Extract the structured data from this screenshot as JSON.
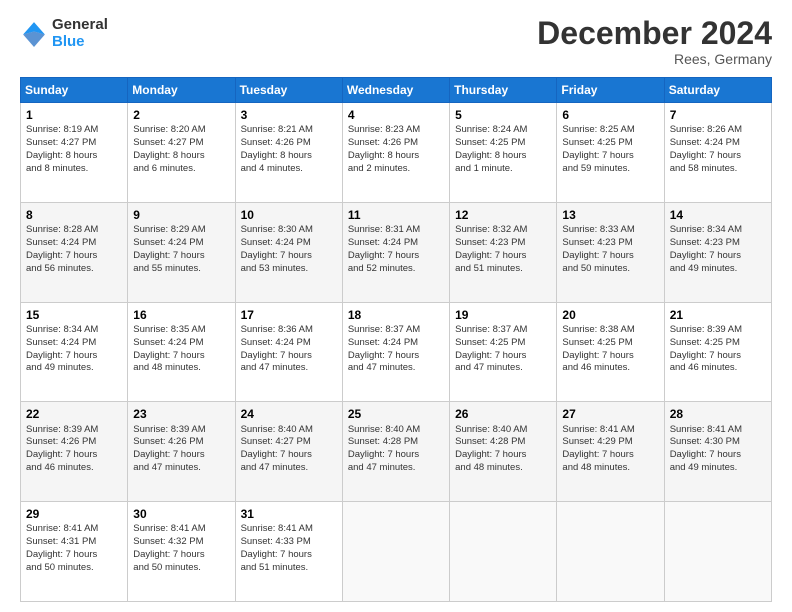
{
  "header": {
    "logo_line1": "General",
    "logo_line2": "Blue",
    "month": "December 2024",
    "location": "Rees, Germany"
  },
  "days_of_week": [
    "Sunday",
    "Monday",
    "Tuesday",
    "Wednesday",
    "Thursday",
    "Friday",
    "Saturday"
  ],
  "weeks": [
    [
      {
        "day": "1",
        "info": "Sunrise: 8:19 AM\nSunset: 4:27 PM\nDaylight: 8 hours\nand 8 minutes."
      },
      {
        "day": "2",
        "info": "Sunrise: 8:20 AM\nSunset: 4:27 PM\nDaylight: 8 hours\nand 6 minutes."
      },
      {
        "day": "3",
        "info": "Sunrise: 8:21 AM\nSunset: 4:26 PM\nDaylight: 8 hours\nand 4 minutes."
      },
      {
        "day": "4",
        "info": "Sunrise: 8:23 AM\nSunset: 4:26 PM\nDaylight: 8 hours\nand 2 minutes."
      },
      {
        "day": "5",
        "info": "Sunrise: 8:24 AM\nSunset: 4:25 PM\nDaylight: 8 hours\nand 1 minute."
      },
      {
        "day": "6",
        "info": "Sunrise: 8:25 AM\nSunset: 4:25 PM\nDaylight: 7 hours\nand 59 minutes."
      },
      {
        "day": "7",
        "info": "Sunrise: 8:26 AM\nSunset: 4:24 PM\nDaylight: 7 hours\nand 58 minutes."
      }
    ],
    [
      {
        "day": "8",
        "info": "Sunrise: 8:28 AM\nSunset: 4:24 PM\nDaylight: 7 hours\nand 56 minutes."
      },
      {
        "day": "9",
        "info": "Sunrise: 8:29 AM\nSunset: 4:24 PM\nDaylight: 7 hours\nand 55 minutes."
      },
      {
        "day": "10",
        "info": "Sunrise: 8:30 AM\nSunset: 4:24 PM\nDaylight: 7 hours\nand 53 minutes."
      },
      {
        "day": "11",
        "info": "Sunrise: 8:31 AM\nSunset: 4:24 PM\nDaylight: 7 hours\nand 52 minutes."
      },
      {
        "day": "12",
        "info": "Sunrise: 8:32 AM\nSunset: 4:23 PM\nDaylight: 7 hours\nand 51 minutes."
      },
      {
        "day": "13",
        "info": "Sunrise: 8:33 AM\nSunset: 4:23 PM\nDaylight: 7 hours\nand 50 minutes."
      },
      {
        "day": "14",
        "info": "Sunrise: 8:34 AM\nSunset: 4:23 PM\nDaylight: 7 hours\nand 49 minutes."
      }
    ],
    [
      {
        "day": "15",
        "info": "Sunrise: 8:34 AM\nSunset: 4:24 PM\nDaylight: 7 hours\nand 49 minutes."
      },
      {
        "day": "16",
        "info": "Sunrise: 8:35 AM\nSunset: 4:24 PM\nDaylight: 7 hours\nand 48 minutes."
      },
      {
        "day": "17",
        "info": "Sunrise: 8:36 AM\nSunset: 4:24 PM\nDaylight: 7 hours\nand 47 minutes."
      },
      {
        "day": "18",
        "info": "Sunrise: 8:37 AM\nSunset: 4:24 PM\nDaylight: 7 hours\nand 47 minutes."
      },
      {
        "day": "19",
        "info": "Sunrise: 8:37 AM\nSunset: 4:25 PM\nDaylight: 7 hours\nand 47 minutes."
      },
      {
        "day": "20",
        "info": "Sunrise: 8:38 AM\nSunset: 4:25 PM\nDaylight: 7 hours\nand 46 minutes."
      },
      {
        "day": "21",
        "info": "Sunrise: 8:39 AM\nSunset: 4:25 PM\nDaylight: 7 hours\nand 46 minutes."
      }
    ],
    [
      {
        "day": "22",
        "info": "Sunrise: 8:39 AM\nSunset: 4:26 PM\nDaylight: 7 hours\nand 46 minutes."
      },
      {
        "day": "23",
        "info": "Sunrise: 8:39 AM\nSunset: 4:26 PM\nDaylight: 7 hours\nand 47 minutes."
      },
      {
        "day": "24",
        "info": "Sunrise: 8:40 AM\nSunset: 4:27 PM\nDaylight: 7 hours\nand 47 minutes."
      },
      {
        "day": "25",
        "info": "Sunrise: 8:40 AM\nSunset: 4:28 PM\nDaylight: 7 hours\nand 47 minutes."
      },
      {
        "day": "26",
        "info": "Sunrise: 8:40 AM\nSunset: 4:28 PM\nDaylight: 7 hours\nand 48 minutes."
      },
      {
        "day": "27",
        "info": "Sunrise: 8:41 AM\nSunset: 4:29 PM\nDaylight: 7 hours\nand 48 minutes."
      },
      {
        "day": "28",
        "info": "Sunrise: 8:41 AM\nSunset: 4:30 PM\nDaylight: 7 hours\nand 49 minutes."
      }
    ],
    [
      {
        "day": "29",
        "info": "Sunrise: 8:41 AM\nSunset: 4:31 PM\nDaylight: 7 hours\nand 50 minutes."
      },
      {
        "day": "30",
        "info": "Sunrise: 8:41 AM\nSunset: 4:32 PM\nDaylight: 7 hours\nand 50 minutes."
      },
      {
        "day": "31",
        "info": "Sunrise: 8:41 AM\nSunset: 4:33 PM\nDaylight: 7 hours\nand 51 minutes."
      },
      null,
      null,
      null,
      null
    ]
  ]
}
